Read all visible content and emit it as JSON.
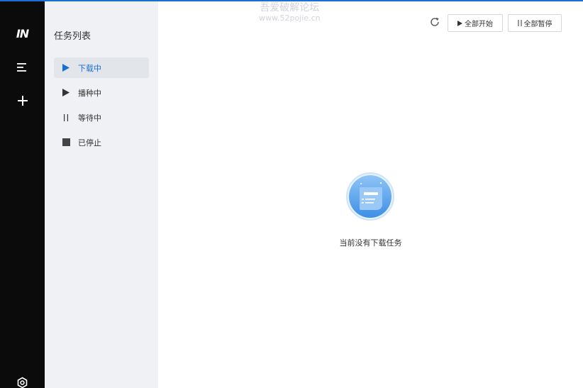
{
  "rail": {
    "logo": "IN",
    "icons": [
      "menu-icon",
      "plus-icon",
      "settings-icon"
    ]
  },
  "panel": {
    "title": "任务列表",
    "items": [
      {
        "label": "下载中",
        "icon": "play-icon",
        "active": true
      },
      {
        "label": "播种中",
        "icon": "play-icon",
        "active": false
      },
      {
        "label": "等待中",
        "icon": "pause-icon",
        "active": false
      },
      {
        "label": "已停止",
        "icon": "stop-icon",
        "active": false
      }
    ]
  },
  "toolbar": {
    "start_all": "全部开始",
    "pause_all": "全部暂停"
  },
  "watermark": {
    "line1": "吾爱破解论坛",
    "line2": "www.52pojie.cn"
  },
  "empty_state": {
    "message": "当前没有下载任务"
  },
  "colors": {
    "accent": "#1a6fd6",
    "rail_bg": "#0b0b0b",
    "panel_bg": "#f0f1f4",
    "active_item_bg": "#e2e5ea"
  }
}
